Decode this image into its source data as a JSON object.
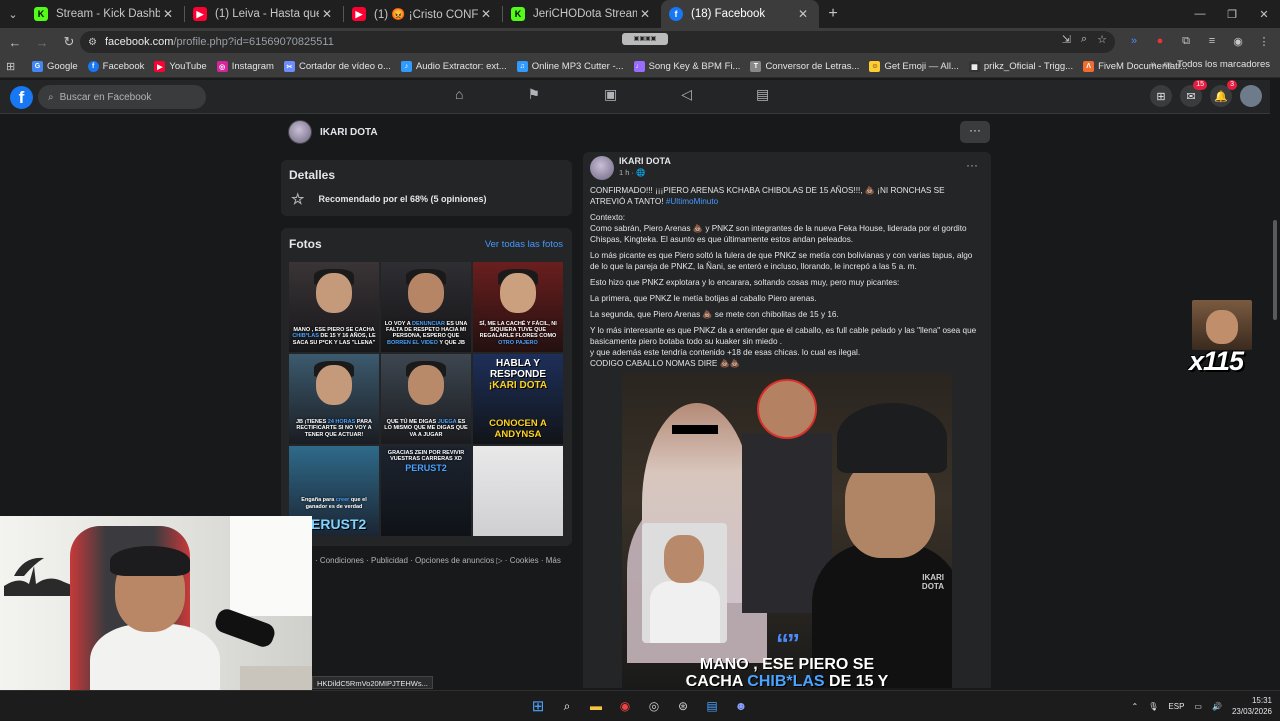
{
  "browser": {
    "tabs": [
      {
        "title": "Stream - Kick Dashboard",
        "icon": "kick-icon",
        "color": "#53fc18"
      },
      {
        "title": "(1) Leiva - Hasta que me quede",
        "icon": "youtube-icon",
        "color": "#ff0033"
      },
      {
        "title": "(1) 😡 ¡Cristo CONFESÓ ser V3",
        "icon": "youtube-icon",
        "color": "#ff0033"
      },
      {
        "title": "JeriCHODota Stream - Watch L",
        "icon": "kick-icon",
        "color": "#53fc18"
      },
      {
        "title": "(18) Facebook",
        "icon": "facebook-icon",
        "color": "#1877f2"
      }
    ],
    "url_host": "facebook.com",
    "url_path": "/profile.php?id=61569070825511",
    "bookmarks": [
      {
        "label": "Google",
        "icon": "google-icon",
        "color": "#4285f4"
      },
      {
        "label": "Facebook",
        "icon": "facebook-icon",
        "color": "#1877f2"
      },
      {
        "label": "YouTube",
        "icon": "youtube-icon",
        "color": "#ff0033"
      },
      {
        "label": "Instagram",
        "icon": "instagram-icon",
        "color": "#d6249f"
      },
      {
        "label": "Cortador de vídeo o...",
        "icon": "scissors-icon",
        "color": "#6c8cff"
      },
      {
        "label": "Audio Extractor: ext...",
        "icon": "audio-icon",
        "color": "#2f9bff"
      },
      {
        "label": "Online MP3 Cutter -...",
        "icon": "mp3-icon",
        "color": "#2f9bff"
      },
      {
        "label": "Song Key & BPM Fi...",
        "icon": "music-icon",
        "color": "#9a6bff"
      },
      {
        "label": "Conversor de Letras...",
        "icon": "text-icon",
        "color": "#888888"
      },
      {
        "label": "Get Emoji — All...",
        "icon": "emoji-icon",
        "color": "#ffcc33"
      },
      {
        "label": "prikz_Oficial - Trigg...",
        "icon": "trigger-icon",
        "color": "#333333"
      },
      {
        "label": "FiveM Documentati...",
        "icon": "fivem-icon",
        "color": "#f26b2f"
      }
    ],
    "bookmarks_folder": "Todos los marcadores"
  },
  "facebook": {
    "search_placeholder": "Buscar en Facebook",
    "messenger_badge": "15",
    "notif_badge": "3"
  },
  "profile": {
    "name": "IKARI DOTA"
  },
  "details": {
    "title": "Detalles",
    "recommendation": "Recomendado por el 68% (5 opiniones)"
  },
  "photos": {
    "title": "Fotos",
    "see_all": "Ver todas las fotos",
    "items": [
      {
        "text_a": "MANO , ESE PIERO SE CACHA ",
        "accent": "CHIB*LAS",
        "text_b": " DE 15 Y 16 AÑOS, LE SACA SU P*CK Y LAS \"LLENA\""
      },
      {
        "text_a": "LO VOY A ",
        "accent": "DENUNCIAR",
        "text_b": " ES UNA FALTA DE RESPETO HACIA MI PERSONA, ESPERO QUE ",
        "accent2": "BORREN EL VIDEO",
        "text_c": " Y QUE JB"
      },
      {
        "text_a": "SÍ, ME LA CACHÉ Y FÁCIL, NI SIQUIERA TUVE QUE REGALARLE FLORES COMO ",
        "accent": "OTRO PAJERO",
        "text_b": ""
      },
      {
        "text_a": "JB ¡TIENES ",
        "accent": "24 HORAS",
        "text_b": " PARA RECTIFICARTE SI NO VOY A TENER QUE ACTUAR!"
      },
      {
        "text_a": "QUE TÚ ME DIGAS ",
        "accent": "JUEGA",
        "text_b": " ES LO MISMO QUE ME DIGAS QUE VA A JUGAR"
      },
      {
        "text_a": "HABLA Y RESPONDE ",
        "accent": "¡KARI DOTA",
        "text_b": "",
        "bottom": "CONOCEN A ANDYNSA"
      },
      {
        "text_a": "Engaña para ",
        "accent": "creer",
        "text_b": " que el ganador es de verdad",
        "big": "PERUST2"
      },
      {
        "text_a": "GRACIAS ZEIN POR REVIVIR VUESTRAS CARRERAS XD",
        "accent": "PERUST2",
        "text_b": ""
      },
      {
        "text_a": "",
        "accent": "",
        "text_b": ""
      }
    ]
  },
  "footer": {
    "links": "· Condiciones · Publicidad · Opciones de anuncios ▷ · Cookies · Más"
  },
  "post": {
    "author": "IKARI DOTA",
    "time": "1 h · 🌐",
    "line1": "CONFIRMADO!!! ¡¡¡PIERO ARENAS KCHABA CHIBOLAS DE 15 AÑOS!!!, 💩 ¡NI RONCHAS SE ATREVIÓ A TANTO! ",
    "hashtag": "#UltimoMinuto",
    "contexto": "Contexto:",
    "p1": "Como sabrán, Piero Arenas 💩 y PNKZ son integrantes de la nueva Feka House, liderada por el gordito Chispas, Kingteka. El asunto es que últimamente estos andan peleados.",
    "p2": "Lo más picante es que Piero soltó la fulera de que PNKZ se metía con bolivianas y con varias tapus, algo de lo que la pareja de PNKZ, la Ñani, se enteró e incluso, llorando, le increpó a las 5 a. m.",
    "p3": "Esto hizo que PNKZ explotara y lo encarara, soltando cosas muy, pero muy picantes:",
    "p4": "La primera, que PNKZ le metía botijas al caballo Piero arenas.",
    "p5": "La segunda, que Piero Arenas 💩 se mete con chibolitas de 15 y 16.",
    "p6a": "Y lo más interesante es que PNKZ da a entender que el caballo, es full cable pelado y las \"llena\" osea que basicamente piero botaba todo su kuaker sin miedo .",
    "p6b": "y que además este tendría contenido +18 de esas chicas. lo cual es ilegal.",
    "p6c": "CODIGO CABALLO NOMAS DIRE 💩💩",
    "image_quote": "“”",
    "image_caption_a": "MANO , ESE PIERO SE",
    "image_caption_b": "CACHA ",
    "image_caption_accent": "CHIB*LAS",
    "image_caption_c": " DE 15 Y",
    "watermark_a": "IKARI",
    "watermark_b": "DOTA"
  },
  "overlay": {
    "reaction_count": "x115",
    "status_url": "HKDildC5RmVo20MIPJTEHWs..."
  },
  "taskbar": {
    "lang": "ESP",
    "time": "15:31",
    "date": "23/03/2026"
  }
}
